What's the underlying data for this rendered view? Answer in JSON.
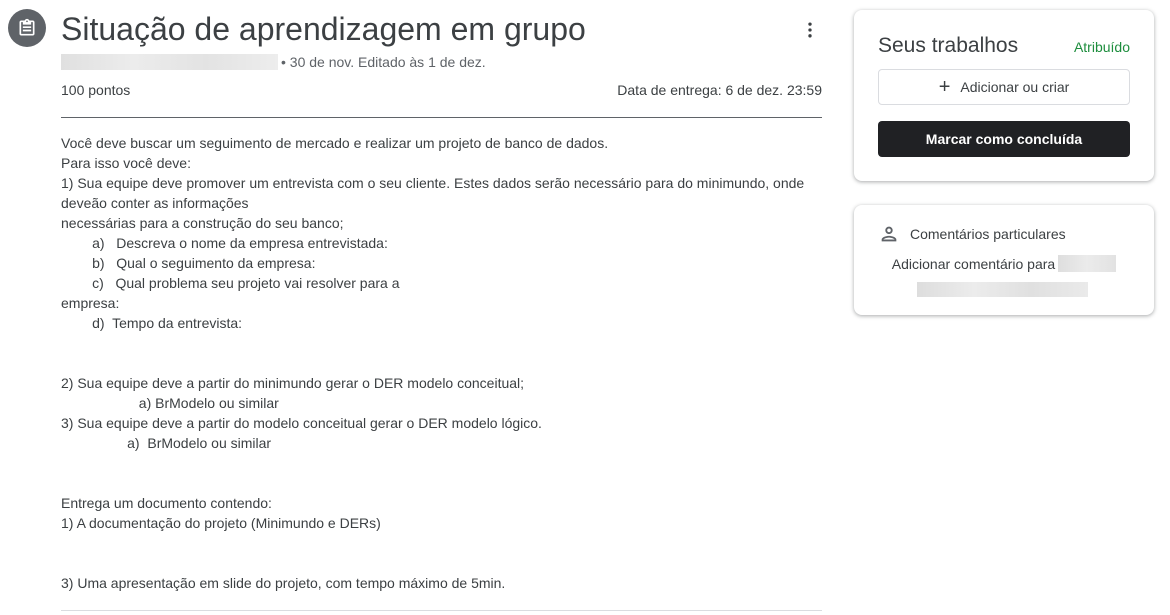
{
  "assignment": {
    "icon": "assignment-icon",
    "title": "Situação de aprendizagem em grupo",
    "meta_text": "• 30 de nov. Editado às 1 de dez.",
    "points": "100 pontos",
    "due": "Data de entrega: 6 de dez. 23:59",
    "description": [
      "Você deve buscar um seguimento de mercado e realizar um projeto de banco de dados.",
      "Para isso você deve:",
      "1) Sua equipe deve promover um entrevista com o seu cliente. Estes dados serão necessário para do minimundo, onde deveão conter as informações",
      "necessárias para a construção do seu banco;",
      "        a)   Descreva o nome da empresa entrevistada:",
      "        b)   Qual o seguimento da empresa:",
      "        c)   Qual problema seu projeto vai resolver para a",
      "empresa:",
      "        d)  Tempo da entrevista:",
      "",
      "",
      "2) Sua equipe deve a partir do minimundo gerar o DER modelo conceitual;",
      "                    a) BrModelo ou similar",
      "3) Sua equipe deve a partir do modelo conceitual gerar o DER modelo lógico.",
      "                 a)  BrModelo ou similar",
      "",
      "",
      "Entrega um documento contendo:",
      "1) A documentação do projeto (Minimundo e DERs)",
      "",
      "",
      "3) Uma apresentação em slide do projeto, com tempo máximo de 5min."
    ]
  },
  "work_card": {
    "title": "Seus trabalhos",
    "status": "Atribuído",
    "add_label": "Adicionar ou criar",
    "done_label": "Marcar como concluída"
  },
  "comments_card": {
    "title": "Comentários particulares",
    "add_label": "Adicionar comentário para"
  },
  "colors": {
    "status_green": "#1e8e3e",
    "primary_dark": "#202124",
    "text": "#3c4043"
  }
}
